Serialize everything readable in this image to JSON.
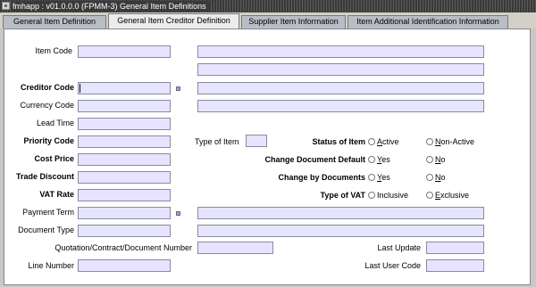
{
  "window": {
    "title": "fmhapp : v01.0.0.0 (FPMM-3) General Item Definitions"
  },
  "tabs": [
    {
      "label": "General Item Definition"
    },
    {
      "label": "General Item Creditor Definition"
    },
    {
      "label": "Supplier Item Information"
    },
    {
      "label": "Item Additional Identification Information"
    }
  ],
  "form": {
    "item_code": "Item Code",
    "creditor_code": "Creditor Code",
    "currency_code": "Currency Code",
    "lead_time": "Lead Time",
    "priority_code": "Priority Code",
    "cost_price": "Cost Price",
    "trade_discount": "Trade Discount",
    "vat_rate": "VAT Rate",
    "payment_term": "Payment Term",
    "document_type": "Document Type",
    "quotation_number": "Quotation/Contract/Document Number",
    "line_number": "Line Number",
    "type_of_item": "Type of Item",
    "last_update": "Last Update",
    "last_user_code": "Last User Code",
    "status_of_item": {
      "label": "Status of Item",
      "options": [
        {
          "key": "A",
          "rest": "ctive"
        },
        {
          "key": "N",
          "rest": "on-Active"
        }
      ]
    },
    "change_document_default": {
      "label": "Change Document Default",
      "options": [
        {
          "key": "Y",
          "rest": "es"
        },
        {
          "key": "N",
          "rest": "o"
        }
      ]
    },
    "change_by_documents": {
      "label": "Change by Documents",
      "options": [
        {
          "key": "Y",
          "rest": "es"
        },
        {
          "key": "N",
          "rest": "o"
        }
      ]
    },
    "type_of_vat": {
      "label": "Type of VAT",
      "options": [
        {
          "key": "",
          "rest": "Inclusive"
        },
        {
          "key": "E",
          "rest": "xclusive"
        }
      ]
    }
  }
}
